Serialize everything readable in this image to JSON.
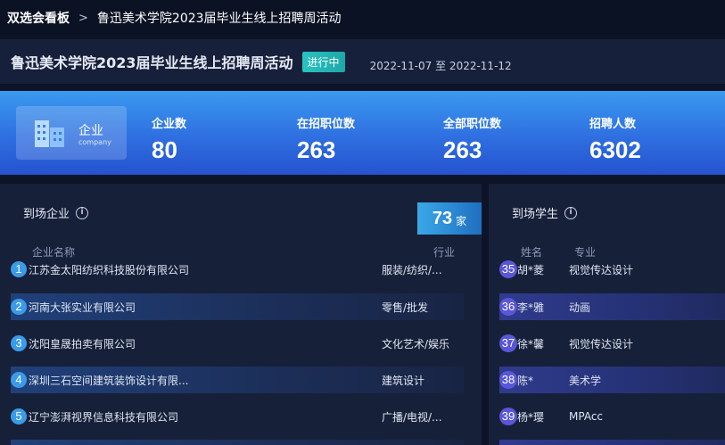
{
  "breadcrumb": {
    "root": "双选会看板",
    "separator": ">",
    "current": "鲁迅美术学院2023届毕业生线上招聘周活动"
  },
  "event": {
    "title": "鲁迅美术学院2023届毕业生线上招聘周活动",
    "status": "进行中",
    "date_range": "2022-11-07 至 2022-11-12"
  },
  "summary": {
    "category_cn": "企业",
    "category_en": "company",
    "stats": [
      {
        "label": "企业数",
        "value": "80"
      },
      {
        "label": "在招职位数",
        "value": "263"
      },
      {
        "label": "全部职位数",
        "value": "263"
      },
      {
        "label": "招聘人数",
        "value": "6302"
      }
    ]
  },
  "companies_panel": {
    "title": "到场企业",
    "info_icon": "info-circle-icon",
    "count": "73",
    "count_unit": "家",
    "col_name": "企业名称",
    "col_industry": "行业",
    "rows": [
      {
        "no": "1",
        "name": "江苏金太阳纺织科技股份有限公司",
        "industry": "服装/纺织/..."
      },
      {
        "no": "2",
        "name": "河南大张实业有限公司",
        "industry": "零售/批发"
      },
      {
        "no": "3",
        "name": "沈阳皇晟拍卖有限公司",
        "industry": "文化艺术/娱乐"
      },
      {
        "no": "4",
        "name": "深圳三石空间建筑装饰设计有限...",
        "industry": "建筑设计"
      },
      {
        "no": "5",
        "name": "辽宁澎湃视界信息科技有限公司",
        "industry": "广播/电视/..."
      }
    ]
  },
  "students_panel": {
    "title": "到场学生",
    "info_icon": "info-circle-icon",
    "col_name": "姓名",
    "col_major": "专业",
    "rows": [
      {
        "no": "35",
        "name": "胡*菱",
        "major": "视觉传达设计"
      },
      {
        "no": "36",
        "name": "李*雅",
        "major": "动画"
      },
      {
        "no": "37",
        "name": "徐*馨",
        "major": "视觉传达设计"
      },
      {
        "no": "38",
        "name": "陈*",
        "major": "美术学"
      },
      {
        "no": "39",
        "name": "杨*璎",
        "major": "MPAcc"
      }
    ]
  },
  "colors": {
    "accent": "#3a9be8",
    "student_badge": "#5a56d8",
    "status_badge": "#29c3c2"
  }
}
